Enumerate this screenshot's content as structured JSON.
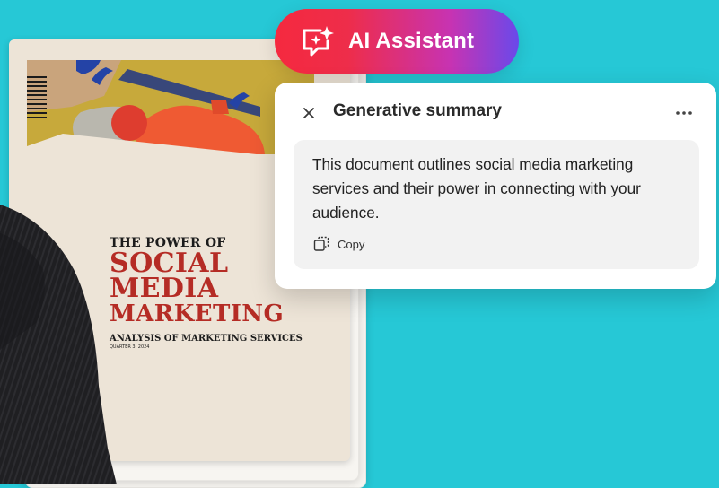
{
  "document": {
    "kicker": "THE POWER OF",
    "headline_line1": "SOCIAL",
    "headline_line2": "MEDIA",
    "headline_line3": "MARKETING",
    "subtitle": "ANALYSIS OF MARKETING SERVICES",
    "subtitle_small": "QUARTER 3, 2024"
  },
  "assistant": {
    "label": "AI Assistant",
    "icon": "ai-sparkle-chat-icon"
  },
  "summary_panel": {
    "title": "Generative summary",
    "close_icon": "close-icon",
    "more_icon": "more-icon",
    "summary_text": "This document outlines social media marketing services and their power in connecting with your audience.",
    "copy_label": "Copy",
    "copy_icon": "copy-icon"
  },
  "colors": {
    "background": "#26c8d6",
    "pill_gradient_start": "#f5293f",
    "pill_gradient_end": "#6a49ea",
    "headline_red": "#b52c25"
  }
}
